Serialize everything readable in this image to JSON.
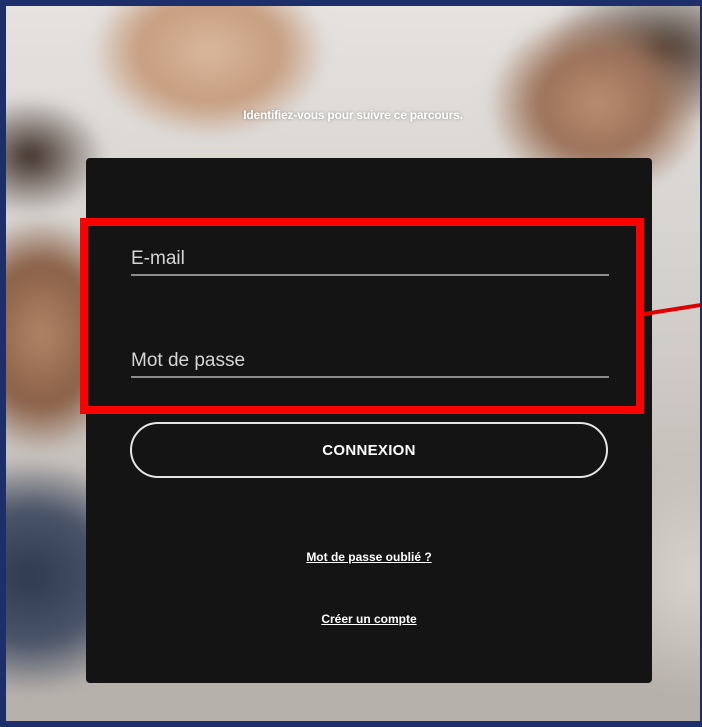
{
  "login": {
    "headline": "Identifiez-vous pour suivre ce parcours.",
    "email_placeholder": "E-mail",
    "email_value": "",
    "password_placeholder": "Mot de passe",
    "password_value": "",
    "connect_label": "CONNEXION",
    "forgot_password_label": "Mot de passe oublié ?",
    "create_account_label": "Créer un compte"
  },
  "annotation": {
    "highlight_color": "#ff0000"
  },
  "colors": {
    "panel_background": "#141414",
    "frame_border": "#1d2f6b"
  }
}
